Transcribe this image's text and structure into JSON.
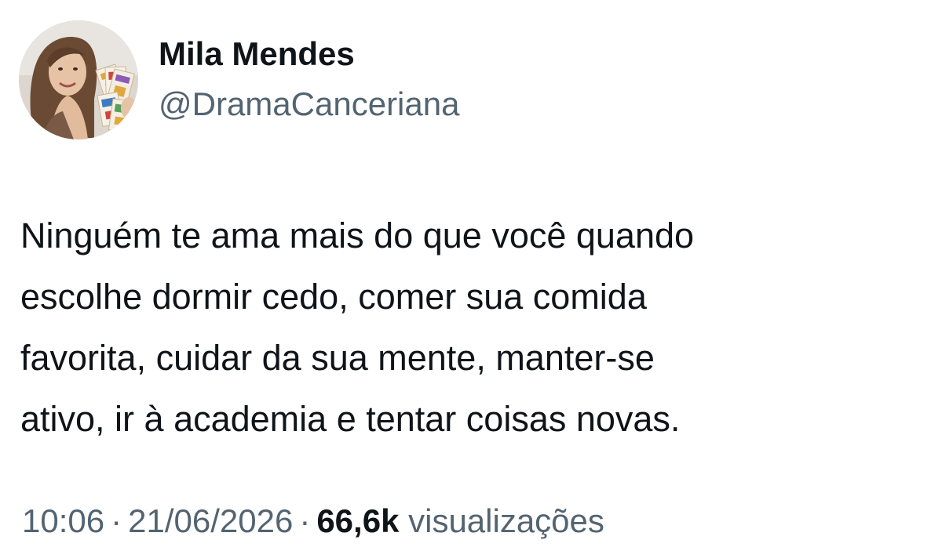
{
  "author": {
    "name": "Mila Mendes",
    "handle": "@DramaCanceriana",
    "avatar_icon": "profile-photo"
  },
  "tweet": {
    "text_lines": [
      "Ninguém te ama mais do que você quando",
      "escolhe dormir cedo, comer sua comida",
      "favorita, cuidar da sua mente, manter-se",
      "ativo, ir à academia e tentar coisas novas."
    ]
  },
  "meta": {
    "time": "10:06",
    "separator": "·",
    "date": "21/06/2026",
    "views_count": "66,6k",
    "views_label": "visualizações"
  },
  "colors": {
    "text_primary": "#0f1419",
    "text_secondary": "#536471",
    "background": "#ffffff"
  }
}
